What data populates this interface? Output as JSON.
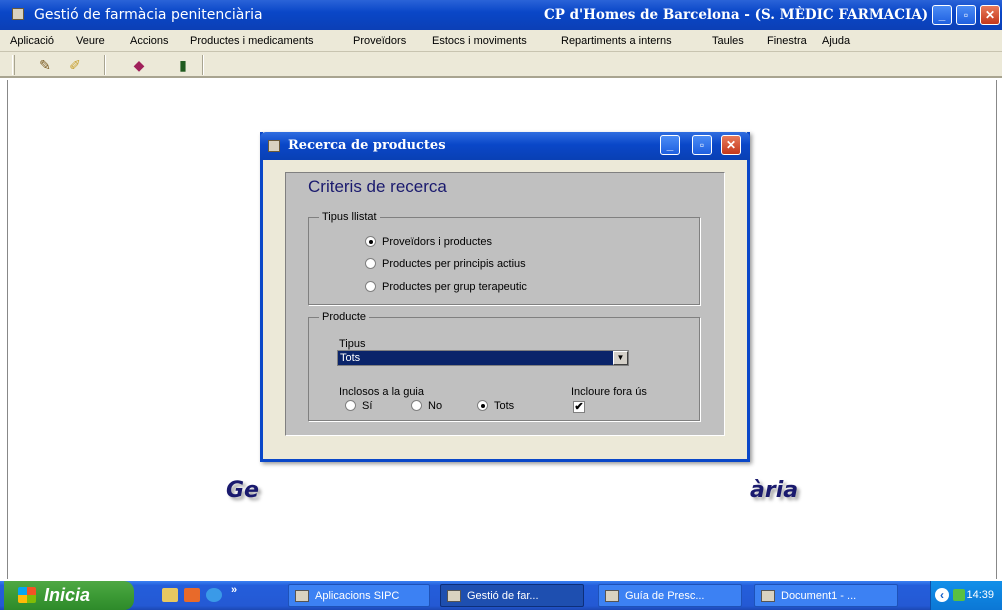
{
  "window": {
    "title": "Gestió de farmàcia penitenciària",
    "context": "CP d'Homes de Barcelona  -  (S. MÈDIC FARMACIA)",
    "minimize": "_",
    "maximize": "▫",
    "close": "✕"
  },
  "menu": [
    "Aplicació",
    "Veure",
    "Accions",
    "Productes i medicaments",
    "Proveïdors",
    "Estocs i moviments",
    "Repartiments a interns",
    "Taules",
    "Finestra",
    "Ajuda"
  ],
  "background_text": {
    "left": "Ge",
    "right": "ària"
  },
  "dialog": {
    "title": "Recerca de productes",
    "heading": "Criteris de recerca",
    "tipus_llistat": {
      "legend": "Tipus llistat",
      "options": [
        "Proveïdors i productes",
        "Productes per principis actius",
        "Productes per grup terapeutic"
      ],
      "selected": 0
    },
    "producte": {
      "legend": "Producte",
      "tipus_label": "Tipus",
      "tipus_value": "Tots",
      "inclosos_label": "Inclosos a la guia",
      "inclosos_options": [
        "Sí",
        "No",
        "Tots"
      ],
      "inclosos_selected": 2,
      "incloure_label": "Incloure fora ús",
      "incloure_checked": true,
      "check_mark": "✔"
    }
  },
  "taskbar": {
    "start": "Inicia",
    "chevron": "»",
    "tasks": [
      "Aplicacions SIPC",
      "Gestió de far...",
      "Guía de Presc...",
      "Document1 - ..."
    ],
    "active_task": 1,
    "tray_chevron": "‹",
    "clock": "14:39"
  },
  "colors": {
    "title_blue": "#0a47c8",
    "heading_navy": "#1a1a6e",
    "dialog_panel": "#c0c0c0"
  }
}
